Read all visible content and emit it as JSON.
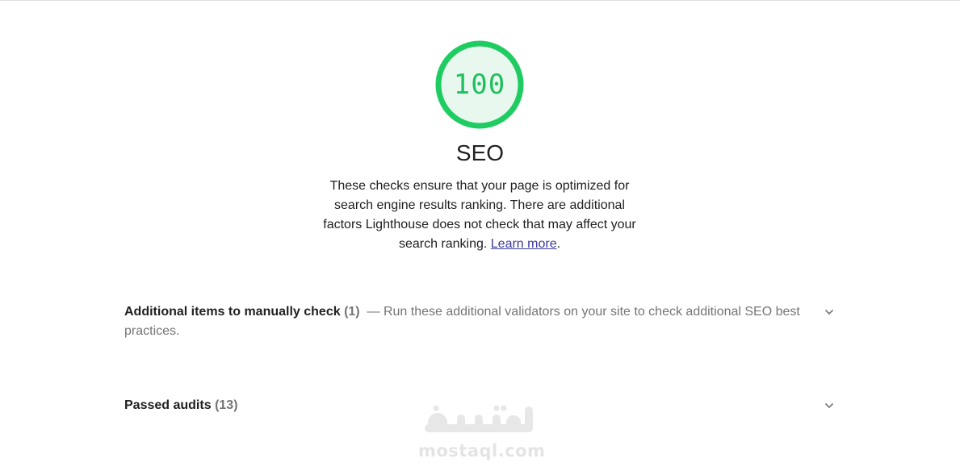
{
  "category": {
    "score": "100",
    "title": "SEO",
    "description": "These checks ensure that your page is optimized for search engine results ranking. There are additional factors Lighthouse does not check that may affect your search ranking.",
    "description_prefix": "These checks ensure that your page is optimized for search engine results ranking. There are additional factors Lighthouse does not check that may affect your search ranking. ",
    "learn_more": "Learn more",
    "description_suffix": ".",
    "score_color": "#1fbf5f",
    "score_bg": "#e8f8ee"
  },
  "groups": [
    {
      "title": "Additional items to manually check",
      "count": "(1)",
      "description": "— Run these additional validators on your site to check additional SEO best practices.",
      "chevron_icon": "chevron-down-icon"
    },
    {
      "title": "Passed audits",
      "count": "(13)",
      "description": "",
      "chevron_icon": "chevron-down-icon"
    }
  ],
  "watermark": {
    "logo_text": "مستقل",
    "domain": "mostaql.com"
  }
}
